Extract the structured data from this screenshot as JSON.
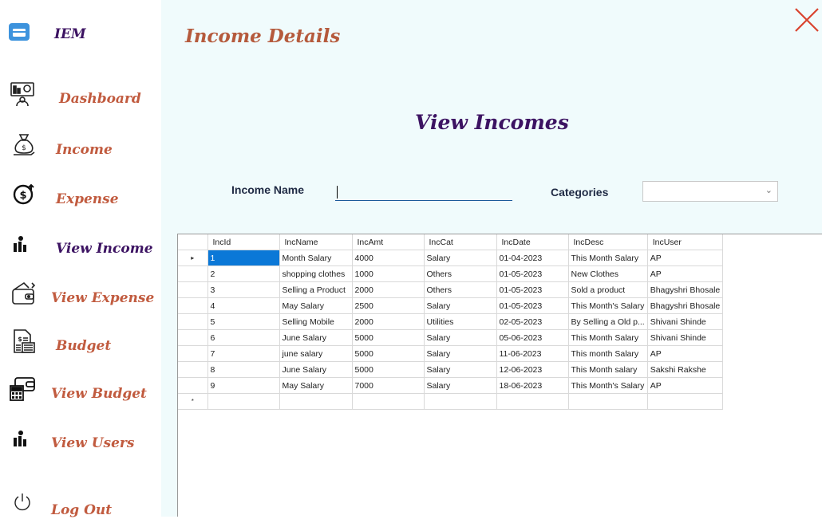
{
  "app": {
    "name": "IEM"
  },
  "sidebar": {
    "items": [
      {
        "label": "Dashboard",
        "icon": "dashboard-icon",
        "color": "#c15b3f"
      },
      {
        "label": "Income",
        "icon": "money-bag-icon",
        "color": "#c15b3f"
      },
      {
        "label": "Expense",
        "icon": "coin-dollar-icon",
        "color": "#c15b3f"
      },
      {
        "label": "View Income",
        "icon": "users-chart-icon",
        "color": "#3c1362"
      },
      {
        "label": "View Expense",
        "icon": "wallet-icon",
        "color": "#c15b3f"
      },
      {
        "label": "Budget",
        "icon": "budget-doc-icon",
        "color": "#c15b3f"
      },
      {
        "label": "View Budget",
        "icon": "calculator-wallet-icon",
        "color": "#c15b3f"
      },
      {
        "label": "View Users",
        "icon": "users-chart-icon",
        "color": "#c15b3f"
      },
      {
        "label": "Log Out",
        "icon": "power-icon",
        "color": "#c15b3f"
      }
    ]
  },
  "header": {
    "title": "Income Details"
  },
  "view": {
    "title": "View Incomes",
    "income_name_label": "Income Name",
    "income_name_value": "",
    "categories_label": "Categories",
    "categories_value": ""
  },
  "grid": {
    "columns": [
      "IncId",
      "IncName",
      "IncAmt",
      "IncCat",
      "IncDate",
      "IncDesc",
      "IncUser"
    ],
    "rows": [
      [
        "1",
        "Month Salary",
        "4000",
        "Salary",
        "01-04-2023",
        "This Month Salary",
        "AP"
      ],
      [
        "2",
        "shopping clothes",
        "1000",
        "Others",
        "01-05-2023",
        "New Clothes",
        "AP"
      ],
      [
        "3",
        "Selling a Product",
        "2000",
        "Others",
        "01-05-2023",
        "Sold a product",
        "Bhagyshri Bhosale"
      ],
      [
        "4",
        "May Salary",
        "2500",
        "Salary",
        "01-05-2023",
        "This Month's Salary",
        "Bhagyshri Bhosale"
      ],
      [
        "5",
        "Selling Mobile",
        "2000",
        "Utilities",
        "02-05-2023",
        "By Selling a Old p...",
        "Shivani Shinde"
      ],
      [
        "6",
        "June Salary",
        "5000",
        "Salary",
        "05-06-2023",
        "This Month Salary",
        "Shivani Shinde"
      ],
      [
        "7",
        "june salary",
        "5000",
        "Salary",
        "11-06-2023",
        "This month Salary",
        "AP"
      ],
      [
        "8",
        "June Salary",
        "5000",
        "Salary",
        "12-06-2023",
        "This Month salary",
        "Sakshi Rakshe"
      ],
      [
        "9",
        "May Salary",
        "7000",
        "Salary",
        "18-06-2023",
        "This Month's Salary",
        "AP"
      ]
    ],
    "current_row_marker": "▸",
    "new_row_marker": "*"
  },
  "colors": {
    "accent": "#c15b3f",
    "active": "#3c1362",
    "selection": "#0b78d7",
    "main_bg": "#f0fbfc"
  }
}
